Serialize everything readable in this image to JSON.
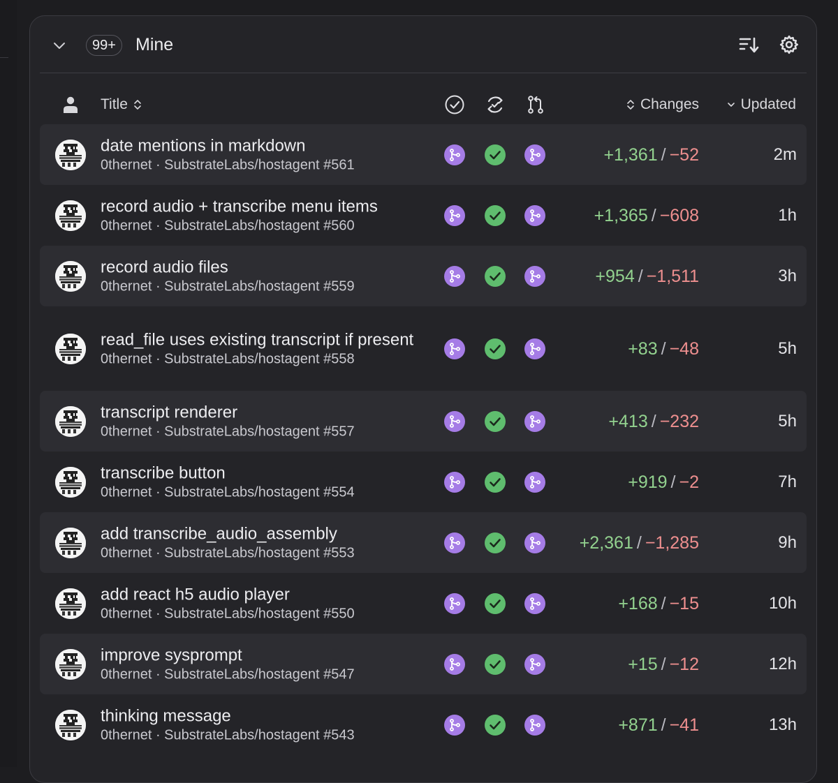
{
  "header": {
    "count_badge": "99+",
    "group_title": "Mine"
  },
  "columns": {
    "title": "Title",
    "changes": "Changes",
    "updated": "Updated"
  },
  "colors": {
    "merge_status": "#a57ce6",
    "check_status": "#5fbd6e",
    "additions": "#93d28f",
    "deletions": "#ee8f8f"
  },
  "rows": [
    {
      "title": "date mentions in markdown",
      "meta": "0thernet · SubstrateLabs/hostagent #561",
      "additions": "+1,361",
      "sep": "/",
      "deletions": "−52",
      "updated": "2m"
    },
    {
      "title": "record audio + transcribe menu items",
      "meta": "0thernet · SubstrateLabs/hostagent #560",
      "additions": "+1,365",
      "sep": "/",
      "deletions": "−608",
      "updated": "1h"
    },
    {
      "title": "record audio files",
      "meta": "0thernet · SubstrateLabs/hostagent #559",
      "additions": "+954",
      "sep": "/",
      "deletions": "−1,511",
      "updated": "3h"
    },
    {
      "title": "read_file uses existing transcript if present",
      "meta": "0thernet · SubstrateLabs/hostagent #558",
      "additions": "+83",
      "sep": "/",
      "deletions": "−48",
      "updated": "5h"
    },
    {
      "title": "transcript renderer",
      "meta": "0thernet · SubstrateLabs/hostagent #557",
      "additions": "+413",
      "sep": "/",
      "deletions": "−232",
      "updated": "5h"
    },
    {
      "title": "transcribe button",
      "meta": "0thernet · SubstrateLabs/hostagent #554",
      "additions": "+919",
      "sep": "/",
      "deletions": "−2",
      "updated": "7h"
    },
    {
      "title": "add transcribe_audio_assembly",
      "meta": "0thernet · SubstrateLabs/hostagent #553",
      "additions": "+2,361",
      "sep": "/",
      "deletions": "−1,285",
      "updated": "9h"
    },
    {
      "title": "add react h5 audio player",
      "meta": "0thernet · SubstrateLabs/hostagent #550",
      "additions": "+168",
      "sep": "/",
      "deletions": "−15",
      "updated": "10h"
    },
    {
      "title": "improve sysprompt",
      "meta": "0thernet · SubstrateLabs/hostagent #547",
      "additions": "+15",
      "sep": "/",
      "deletions": "−12",
      "updated": "12h"
    },
    {
      "title": "thinking message",
      "meta": "0thernet · SubstrateLabs/hostagent #543",
      "additions": "+871",
      "sep": "/",
      "deletions": "−41",
      "updated": "13h"
    }
  ]
}
